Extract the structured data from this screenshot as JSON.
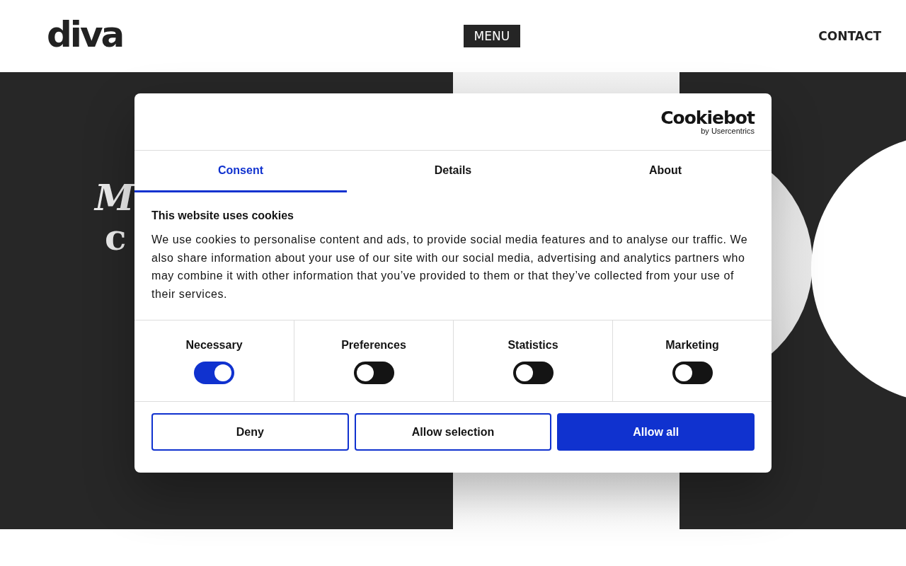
{
  "header": {
    "logo": "diva",
    "menu_button": "MENU",
    "contact_link": "CONTACT"
  },
  "hero": {
    "heading_lines": [
      "M",
      "c"
    ]
  },
  "cookie_dialog": {
    "brand": {
      "name": "Cookiebot",
      "byline": "by Usercentrics"
    },
    "tabs": [
      {
        "label": "Consent",
        "selected": true
      },
      {
        "label": "Details",
        "selected": false
      },
      {
        "label": "About",
        "selected": false
      }
    ],
    "title": "This website uses cookies",
    "body": "We use cookies to personalise content and ads, to provide social media features and to analyse our traffic. We also share information about your use of our site with our social media, advertising and analytics partners who may combine it with other information that you’ve provided to them or that they’ve collected from your use of their services.",
    "categories": [
      {
        "label": "Necessary",
        "on": true
      },
      {
        "label": "Preferences",
        "on": false
      },
      {
        "label": "Statistics",
        "on": false
      },
      {
        "label": "Marketing",
        "on": false
      }
    ],
    "buttons": [
      {
        "label": "Deny",
        "kind": "outline"
      },
      {
        "label": "Allow selection",
        "kind": "outline"
      },
      {
        "label": "Allow all",
        "kind": "primary"
      }
    ]
  }
}
